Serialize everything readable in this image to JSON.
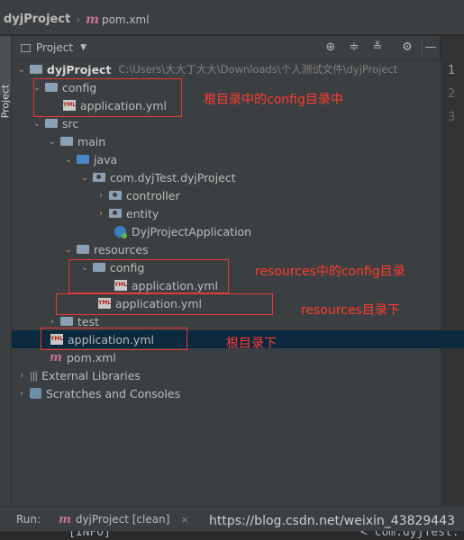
{
  "breadcrumb": {
    "project": "dyjProject",
    "file": "pom.xml"
  },
  "left_tab": "Project",
  "panel": {
    "title": "Project"
  },
  "tree": [
    {
      "label": "dyjProject",
      "path": "C:\\Users\\大大丁大大\\Downloads\\个人测试文件\\dyjProject"
    },
    {
      "label": "config"
    },
    {
      "label": "application.yml"
    },
    {
      "label": "src"
    },
    {
      "label": "main"
    },
    {
      "label": "java"
    },
    {
      "label": "com.dyjTest.dyjProject"
    },
    {
      "label": "controller"
    },
    {
      "label": "entity"
    },
    {
      "label": "DyjProjectApplication"
    },
    {
      "label": "resources"
    },
    {
      "label": "config"
    },
    {
      "label": "application.yml"
    },
    {
      "label": "application.yml"
    },
    {
      "label": "test"
    },
    {
      "label": "application.yml"
    },
    {
      "label": "pom.xml"
    },
    {
      "label": "External Libraries"
    },
    {
      "label": "Scratches and Consoles"
    }
  ],
  "annotations": {
    "root_config": "根目录中的config目录中",
    "resources_config": "resources中的config目录",
    "resources_dir": "resources目录下",
    "root_dir": "根目录下"
  },
  "line_numbers": [
    "1",
    "2",
    "3"
  ],
  "run_bar": {
    "label": "Run:",
    "tab": "dyjProject [clean]",
    "close": "×"
  },
  "watermark": "https://blog.csdn.net/weixin_43829443",
  "console_peek": {
    "left": "[INFO]",
    "right": "< com.dyjTest:"
  },
  "icons": {
    "maven": "m",
    "yml": "YML"
  },
  "colors": {
    "background": "#2b2b2b",
    "panel": "#3c3f41",
    "selection": "#0d293e",
    "annotation": "#ff3b30",
    "source_folder": "#4a87c7"
  }
}
